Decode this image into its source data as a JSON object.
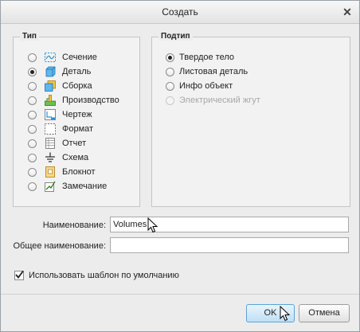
{
  "window": {
    "title": "Создать",
    "close_symbol": "✕"
  },
  "type_group": {
    "legend": "Тип",
    "options": [
      {
        "label": "Сечение",
        "icon": "section-icon",
        "selected": false
      },
      {
        "label": "Деталь",
        "icon": "part-icon",
        "selected": true
      },
      {
        "label": "Сборка",
        "icon": "assembly-icon",
        "selected": false
      },
      {
        "label": "Производство",
        "icon": "manufacturing-icon",
        "selected": false
      },
      {
        "label": "Чертеж",
        "icon": "drawing-icon",
        "selected": false
      },
      {
        "label": "Формат",
        "icon": "format-icon",
        "selected": false
      },
      {
        "label": "Отчет",
        "icon": "report-icon",
        "selected": false
      },
      {
        "label": "Схема",
        "icon": "diagram-icon",
        "selected": false
      },
      {
        "label": "Блокнот",
        "icon": "notebook-icon",
        "selected": false
      },
      {
        "label": "Замечание",
        "icon": "markup-icon",
        "selected": false
      }
    ]
  },
  "subtype_group": {
    "legend": "Подтип",
    "options": [
      {
        "label": "Твердое тело",
        "selected": true,
        "enabled": true
      },
      {
        "label": "Листовая деталь",
        "selected": false,
        "enabled": true
      },
      {
        "label": "Инфо объект",
        "selected": false,
        "enabled": true
      },
      {
        "label": "Электрический жгут",
        "selected": false,
        "enabled": false
      }
    ]
  },
  "name_field": {
    "label": "Наименование:",
    "value": "Volumes"
  },
  "common_name_field": {
    "label": "Общее наименование:",
    "value": ""
  },
  "default_template": {
    "label": "Использовать шаблон по умолчанию",
    "checked": true
  },
  "buttons": {
    "ok_label": "OK",
    "cancel_label": "Отмена"
  },
  "colors": {
    "dialog_background": "#ececec",
    "group_background": "#f2f2f2",
    "ok_button_border": "#5ba4d6",
    "icon_blue": "#2a8fd6",
    "icon_green": "#3a9a2a",
    "disabled_text": "#a8a8a8"
  }
}
